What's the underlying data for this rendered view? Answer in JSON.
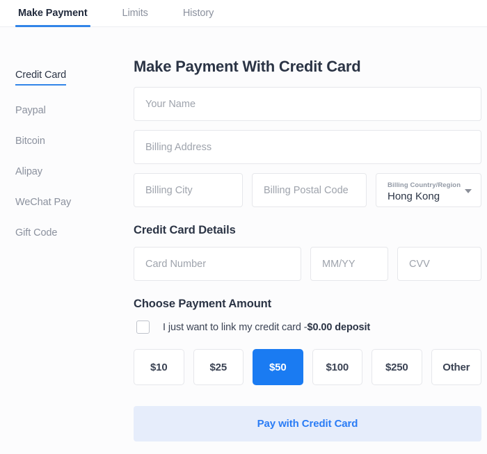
{
  "tabs": [
    {
      "label": "Make Payment",
      "active": true
    },
    {
      "label": "Limits",
      "active": false
    },
    {
      "label": "History",
      "active": false
    }
  ],
  "sidebar": {
    "items": [
      {
        "label": "Credit Card",
        "active": true
      },
      {
        "label": "Paypal",
        "active": false
      },
      {
        "label": "Bitcoin",
        "active": false
      },
      {
        "label": "Alipay",
        "active": false
      },
      {
        "label": "WeChat Pay",
        "active": false
      },
      {
        "label": "Gift Code",
        "active": false
      }
    ]
  },
  "main": {
    "title": "Make Payment With Credit Card",
    "billing": {
      "name_placeholder": "Your Name",
      "address_placeholder": "Billing Address",
      "city_placeholder": "Billing City",
      "postal_placeholder": "Billing Postal Code",
      "country_label": "Billing Country/Region",
      "country_value": "Hong Kong"
    },
    "card_section": {
      "heading": "Credit Card Details",
      "number_placeholder": "Card Number",
      "expiry_placeholder": "MM/YY",
      "cvv_placeholder": "CVV"
    },
    "amount_section": {
      "heading": "Choose Payment Amount",
      "link_checkbox_text": "I just want to link my credit card -",
      "link_checkbox_bold": "$0.00 deposit",
      "checkbox_checked": false,
      "options": [
        {
          "label": "$10",
          "selected": false
        },
        {
          "label": "$25",
          "selected": false
        },
        {
          "label": "$50",
          "selected": true
        },
        {
          "label": "$100",
          "selected": false
        },
        {
          "label": "$250",
          "selected": false
        },
        {
          "label": "Other",
          "selected": false
        }
      ]
    },
    "submit_label": "Pay with Credit Card"
  },
  "colors": {
    "accent": "#1a7bf2",
    "accent_soft": "#e6edfb",
    "text": "#2b3445",
    "muted": "#8b919e",
    "border": "#e6e7eb"
  }
}
